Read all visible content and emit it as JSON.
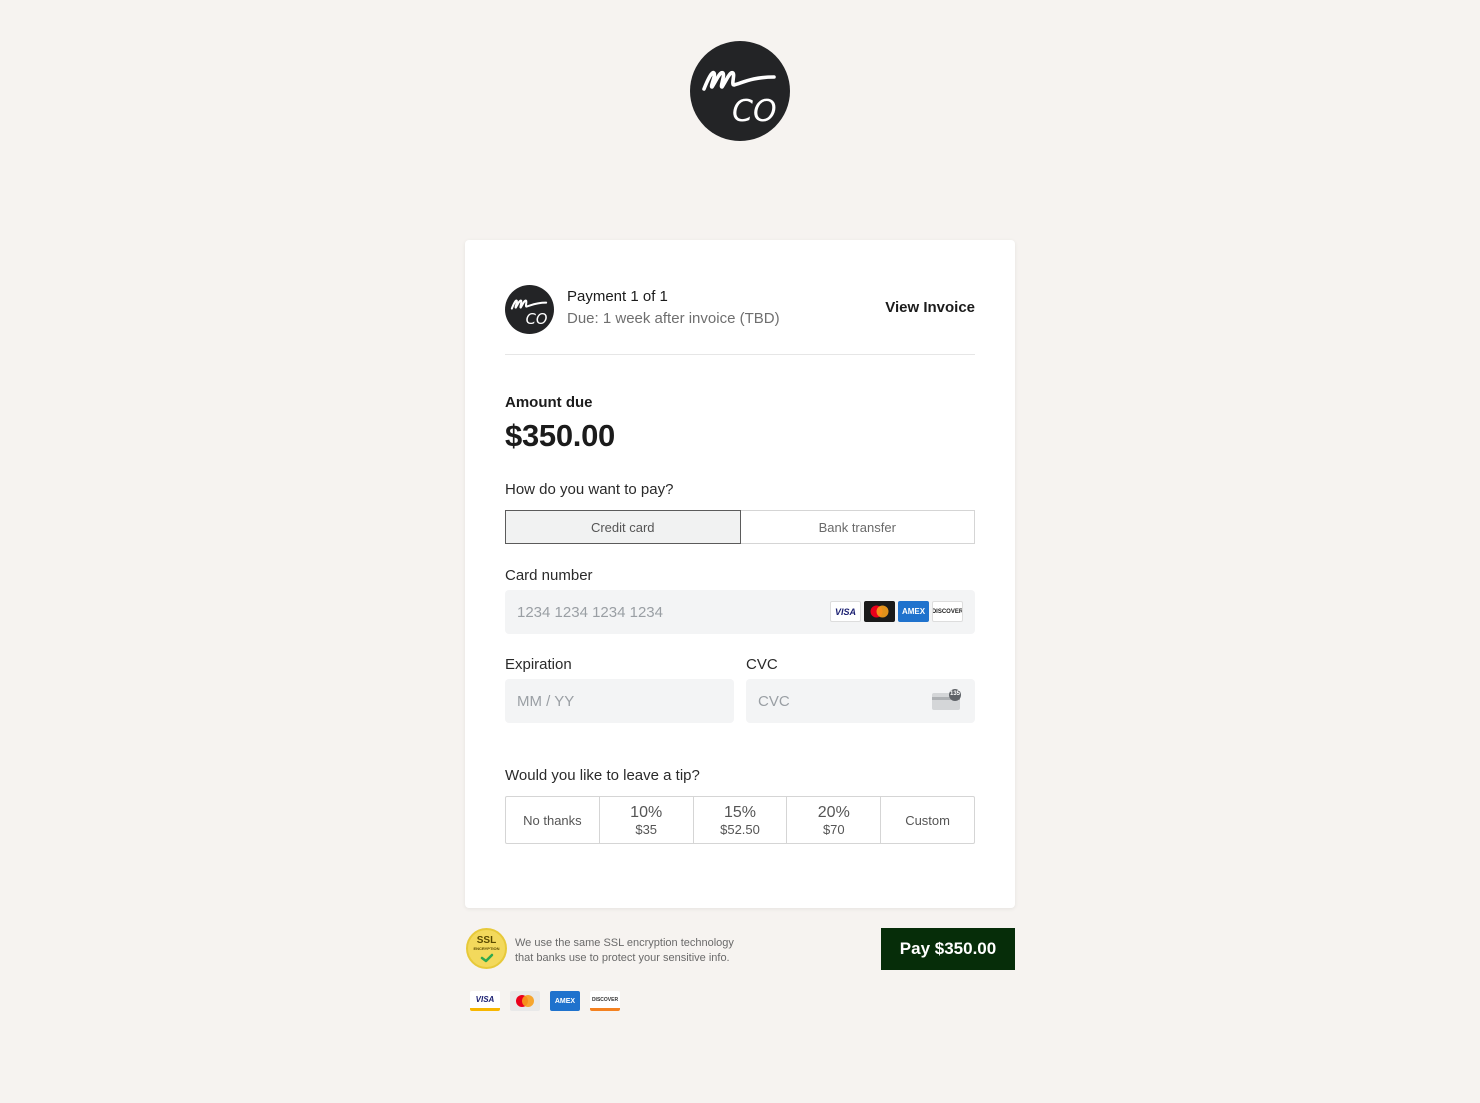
{
  "brand": {
    "logo_text": "mco"
  },
  "payment": {
    "title": "Payment 1 of 1",
    "due": "Due: 1 week after invoice (TBD)",
    "view_invoice": "View Invoice"
  },
  "amount": {
    "label": "Amount due",
    "value": "$350.00"
  },
  "method": {
    "question": "How do you want to pay?",
    "options": [
      {
        "label": "Credit card",
        "selected": true
      },
      {
        "label": "Bank transfer",
        "selected": false
      }
    ]
  },
  "card_form": {
    "card_number_label": "Card number",
    "card_number_placeholder": "1234 1234 1234 1234",
    "expiration_label": "Expiration",
    "expiration_placeholder": "MM / YY",
    "cvc_label": "CVC",
    "cvc_placeholder": "CVC",
    "cvc_icon_text": "135",
    "brands": [
      "VISA",
      "mastercard",
      "AMEX",
      "DISCOVER"
    ]
  },
  "tip": {
    "question": "Would you like to leave a tip?",
    "options": [
      {
        "label": "No thanks"
      },
      {
        "percent": "10%",
        "amount": "$35"
      },
      {
        "percent": "15%",
        "amount": "$52.50"
      },
      {
        "percent": "20%",
        "amount": "$70"
      },
      {
        "label": "Custom"
      }
    ]
  },
  "footer": {
    "ssl_badge_text": "SSL",
    "ssl_badge_sub": "ENCRYPTION",
    "ssl_line1": "We use the same SSL encryption technology",
    "ssl_line2": "that banks use to protect your sensitive info.",
    "pay_button": "Pay $350.00",
    "brands": [
      "VISA",
      "mastercard",
      "AMEX",
      "DISCOVER"
    ]
  },
  "colors": {
    "background": "#f6f3f0",
    "pay_button": "#062d09",
    "logo": "#232426"
  }
}
